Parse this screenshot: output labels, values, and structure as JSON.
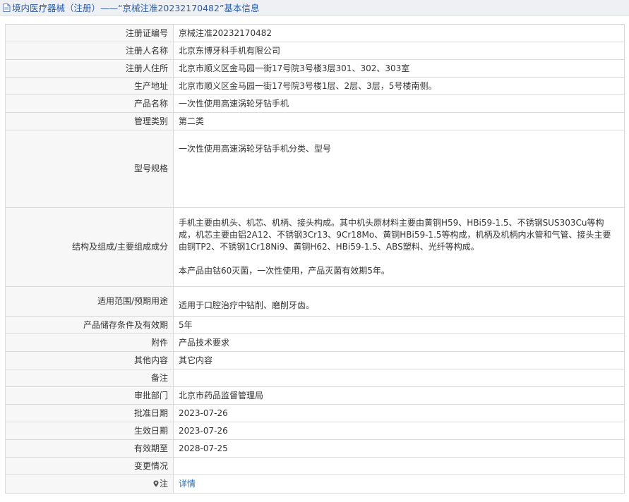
{
  "header": {
    "title": "境内医疗器械（注册）——“京械注准20232170482”基本信息"
  },
  "rows": {
    "reg_no": {
      "label": "注册证编号",
      "value": "京械注准20232170482"
    },
    "registrant": {
      "label": "注册人名称",
      "value": "北京东博牙科手机有限公司"
    },
    "registrant_addr": {
      "label": "注册人住所",
      "value": "北京市顺义区金马园一街17号院3号楼3层301、302、303室"
    },
    "prod_addr": {
      "label": "生产地址",
      "value": "北京市顺义区金马园一街17号院3号楼1层、2层、3层，5号楼南侧。"
    },
    "prod_name": {
      "label": "产品名称",
      "value": "一次性使用高速涡轮牙钻手机"
    },
    "category": {
      "label": "管理类别",
      "value": "第二类"
    },
    "model": {
      "label": "型号规格",
      "value": "一次性使用高速涡轮牙钻手机分类、型号"
    },
    "structure": {
      "label": "结构及组成/主要组成成分",
      "value": "手机主要由机头、机芯、机柄、接头构成。其中机头原材料主要由黄铜H59、HBi59-1.5、不锈钢SUS303Cu等构成，机芯主要由铝2A12、不锈钢3Cr13、9Cr18Mo、黄铜HBi59-1.5等构成，机柄及机柄内水管和气管、接头主要由铜TP2、不锈钢1Cr18Ni9、黄铜H62、HBi59-1.5、ABS塑料、光纤等构成。\n\n本产品由钴60灭菌，一次性使用，产品灭菌有效期5年。"
    },
    "scope": {
      "label": "适用范围/预期用途",
      "value": "适用于口腔治疗中钻削、磨削牙齿。"
    },
    "storage": {
      "label": "产品储存条件及有效期",
      "value": "5年"
    },
    "attachment": {
      "label": "附件",
      "value": "产品技术要求"
    },
    "other": {
      "label": "其他内容",
      "value": "其它内容"
    },
    "remark": {
      "label": "备注",
      "value": ""
    },
    "dept": {
      "label": "审批部门",
      "value": "北京市药品监督管理局"
    },
    "approve_date": {
      "label": "批准日期",
      "value": "2023-07-26"
    },
    "effective_date": {
      "label": "生效日期",
      "value": "2023-07-26"
    },
    "expire_date": {
      "label": "有效期至",
      "value": "2028-07-25"
    },
    "change": {
      "label": "变更情况",
      "value": ""
    },
    "note": {
      "label": "注",
      "value": "详情"
    }
  },
  "colors": {
    "title_text": "#2a5ba6",
    "link": "#2a6ebb",
    "label_bg": "#f7f7f7",
    "border": "#d9d9d9"
  },
  "icons": {
    "title": "document-icon",
    "note": "map-pin-icon"
  }
}
